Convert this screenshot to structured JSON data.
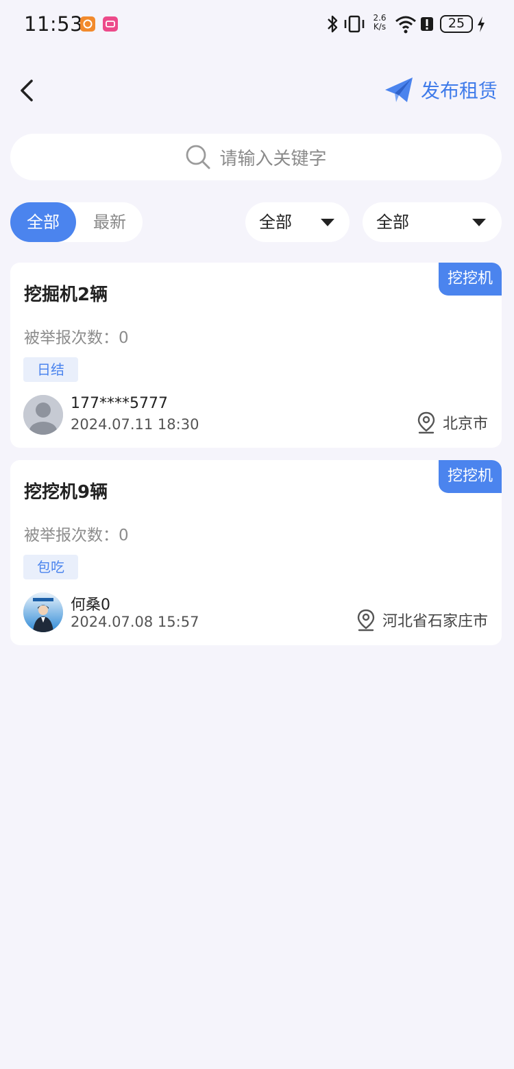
{
  "status_bar": {
    "time": "11:53",
    "net_speed_top": "2.6",
    "net_speed_bottom": "K/s",
    "battery": "25"
  },
  "nav": {
    "publish_label": "发布租赁"
  },
  "search": {
    "placeholder": "请输入关键字"
  },
  "filters": {
    "segment": [
      "全部",
      "最新"
    ],
    "dropdown1": "全部",
    "dropdown2": "全部"
  },
  "listings": [
    {
      "tag": "挖挖机",
      "title": "挖掘机2辆",
      "report": "被举报次数：0",
      "label": "日结",
      "user": "177****5777",
      "time": "2024.07.11 18:30",
      "location": "北京市"
    },
    {
      "tag": "挖挖机",
      "title": "挖挖机9辆",
      "report": "被举报次数：0",
      "label": "包吃",
      "user": "何桑0",
      "time": "2024.07.08 15:57",
      "location": "河北省石家庄市"
    }
  ],
  "colors": {
    "accent": "#4b84ee",
    "background": "#f5f4fb",
    "label_bg": "#e9effb"
  }
}
